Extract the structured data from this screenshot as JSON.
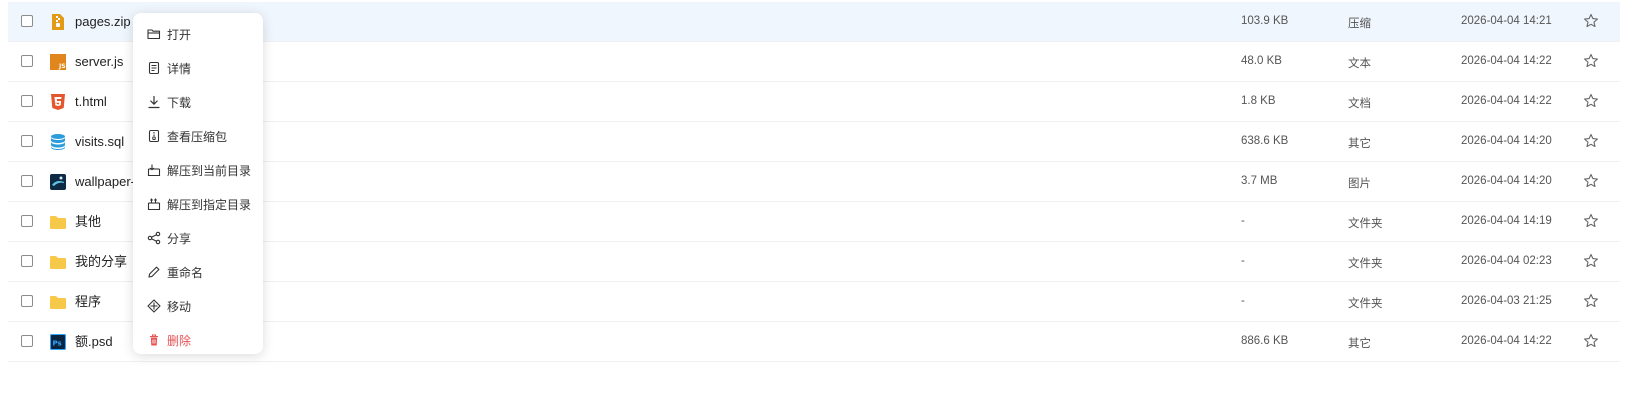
{
  "files": [
    {
      "name": "pages.zip",
      "icon": "zip-icon",
      "size": "103.9 KB",
      "type": "压缩",
      "date": "2026-04-04 14:21",
      "selected": true
    },
    {
      "name": "server.js",
      "icon": "js-file-icon",
      "size": "48.0 KB",
      "type": "文本",
      "date": "2026-04-04 14:22"
    },
    {
      "name": "t.html",
      "icon": "html-file-icon",
      "size": "1.8 KB",
      "type": "文档",
      "date": "2026-04-04 14:22"
    },
    {
      "name": "visits.sql",
      "icon": "database-icon",
      "size": "638.6 KB",
      "type": "其它",
      "date": "2026-04-04 14:20"
    },
    {
      "name": "wallpaper-",
      "icon": "image-file-icon",
      "size": "3.7 MB",
      "type": "图片",
      "date": "2026-04-04 14:20"
    },
    {
      "name": "其他",
      "icon": "folder-icon",
      "size": "-",
      "type": "文件夹",
      "date": "2026-04-04 14:19"
    },
    {
      "name": "我的分享",
      "icon": "folder-icon",
      "size": "-",
      "type": "文件夹",
      "date": "2026-04-04 02:23"
    },
    {
      "name": "程序",
      "icon": "folder-icon",
      "size": "-",
      "type": "文件夹",
      "date": "2026-04-03 21:25"
    },
    {
      "name": "额.psd",
      "icon": "psd-file-icon",
      "size": "886.6 KB",
      "type": "其它",
      "date": "2026-04-04 14:22"
    }
  ],
  "context_menu": {
    "open": "打开",
    "details": "详情",
    "download": "下载",
    "view_archive": "查看压缩包",
    "extract_here": "解压到当前目录",
    "extract_to": "解压到指定目录",
    "share": "分享",
    "rename": "重命名",
    "move": "移动",
    "delete": "删除"
  },
  "colors": {
    "selected_row": "#f0f6fd",
    "danger": "#e55353",
    "folder": "#f7c948"
  }
}
